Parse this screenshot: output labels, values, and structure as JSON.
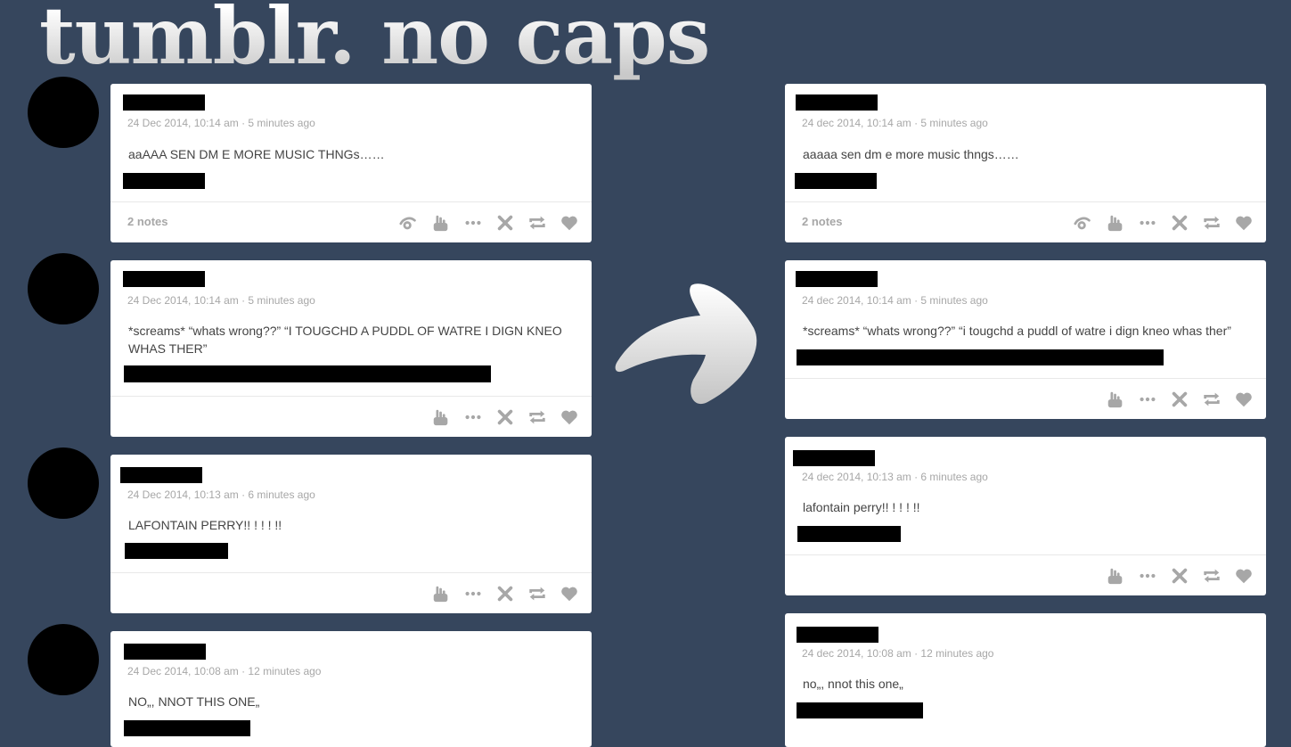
{
  "meme_title": "tumblr. no caps",
  "left_posts": [
    {
      "meta": "24 Dec 2014, 10:14 am · 5 minutes ago",
      "text": "aaAAA SEN DM E MORE MUSIC THNGs……",
      "notes": "2 notes"
    },
    {
      "meta": "24 Dec 2014, 10:14 am · 5 minutes ago",
      "text": "*screams* “whats wrong??” “I TOUGCHD A PUDDL OF WATRE I DIGN KNEO WHAS THER”"
    },
    {
      "meta": "24 Dec 2014, 10:13 am · 6 minutes ago",
      "text": "LAFONTAIN PERRY!! !  ! ! !!"
    },
    {
      "meta": "24 Dec 2014, 10:08 am · 12 minutes ago",
      "text": "NO„, NNOT THIS ONE„"
    }
  ],
  "right_posts": [
    {
      "meta": "24 dec 2014, 10:14 am · 5 minutes ago",
      "text": "aaaaa sen dm e more music thngs……",
      "notes": "2 notes"
    },
    {
      "meta": "24 dec 2014, 10:14 am · 5 minutes ago",
      "text": "*screams* “whats wrong??” “i tougchd a puddl of watre i dign kneo whas ther”"
    },
    {
      "meta": "24 dec 2014, 10:13 am · 6 minutes ago",
      "text": "lafontain perry!! !  ! ! !!"
    },
    {
      "meta": "24 dec 2014, 10:08 am · 12 minutes ago",
      "text": "no„, nnot this one„"
    }
  ],
  "icons": {
    "accent_bg": "#36465d",
    "action_color": "#a7a7a7"
  }
}
